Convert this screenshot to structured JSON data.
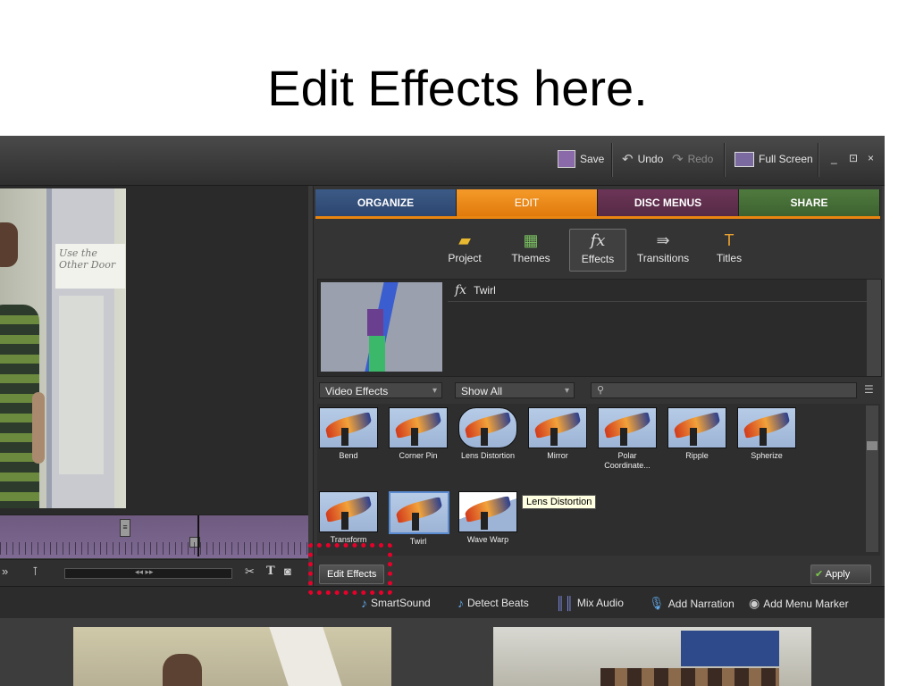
{
  "slide": {
    "title": "Edit Effects here."
  },
  "toolbar": {
    "save": "Save",
    "undo": "Undo",
    "redo": "Redo",
    "full_screen": "Full Screen",
    "window_controls": [
      "_",
      "⊡",
      "×"
    ]
  },
  "video": {
    "sign_text": "Use the Other Door"
  },
  "tabs": [
    {
      "label": "ORGANIZE",
      "active": false
    },
    {
      "label": "EDIT",
      "active": true
    },
    {
      "label": "DISC MENUS",
      "active": false
    },
    {
      "label": "SHARE",
      "active": false
    }
  ],
  "tools": [
    {
      "label": "Project",
      "icon": "project-icon"
    },
    {
      "label": "Themes",
      "icon": "themes-icon"
    },
    {
      "label": "Effects",
      "icon": "effects-fx-icon",
      "active": true
    },
    {
      "label": "Transitions",
      "icon": "transitions-icon"
    },
    {
      "label": "Titles",
      "icon": "titles-icon"
    }
  ],
  "preview": {
    "selected_effect": "Twirl"
  },
  "filters": {
    "category": "Video Effects",
    "show": "Show All",
    "search_placeholder": ""
  },
  "effects": [
    {
      "name": "Bend"
    },
    {
      "name": "Corner Pin"
    },
    {
      "name": "Lens Distortion"
    },
    {
      "name": "Mirror"
    },
    {
      "name": "Polar Coordinate..."
    },
    {
      "name": "Ripple"
    },
    {
      "name": "Spherize"
    },
    {
      "name": "Transform"
    },
    {
      "name": "Twirl",
      "selected": true
    },
    {
      "name": "Wave Warp"
    }
  ],
  "tooltip": "Lens Distortion",
  "actions": {
    "edit_effects": "Edit Effects",
    "apply": "Apply"
  },
  "bottom_bar": {
    "smartsound": "SmartSound",
    "detect_beats": "Detect Beats",
    "mix_audio": "Mix Audio",
    "add_narration": "Add Narration",
    "add_menu_marker": "Add Menu Marker"
  },
  "colors": {
    "edit_tab": "#f08a1c",
    "organize_tab": "#3c5a86",
    "disc_tab": "#6c3557",
    "share_tab": "#4f7a3e",
    "highlight": "#e8002a"
  }
}
